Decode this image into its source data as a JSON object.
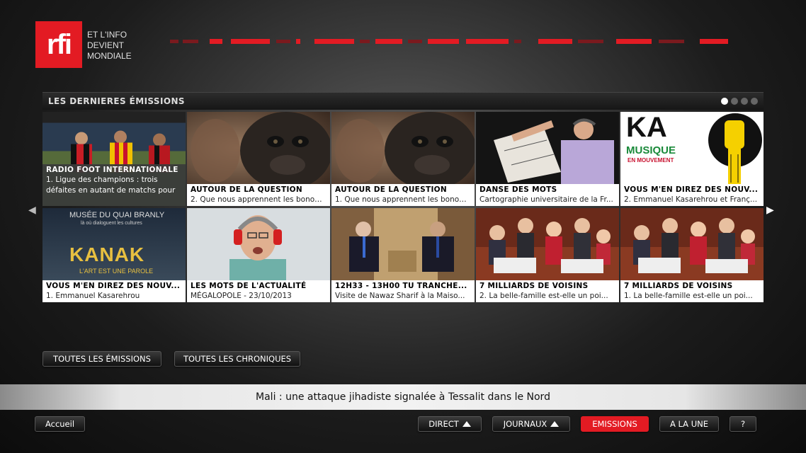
{
  "brand": {
    "logo_text": "rfi",
    "tagline": [
      "ET L'INFO",
      "DEVIENT",
      "MONDIALE"
    ],
    "accent_color": "#e31b23"
  },
  "section": {
    "title": "LES DERNIERES ÉMISSIONS",
    "page_count": 4,
    "current_page": 1
  },
  "tiles_row1": [
    {
      "title": "RADIO FOOT INTERNATIONALE",
      "subtitle": "1. Ligue des champions : trois défaites en autant de matchs pour",
      "image": "football-players"
    },
    {
      "title": "AUTOUR DE LA QUESTION",
      "subtitle": "2. Que nous apprennent les bonobo...",
      "image": "bonobo"
    },
    {
      "title": "AUTOUR DE LA QUESTION",
      "subtitle": "1. Que nous apprennent les bonobo...",
      "image": "bonobo"
    },
    {
      "title": "DANSE DES MOTS",
      "subtitle": "Cartographie universitaire de la Fr...",
      "image": "man-with-map"
    },
    {
      "title": "VOUS M'EN DIREZ DES NOUV...",
      "subtitle": "2. Emmanuel Kasarehrou et Franç...",
      "image": "ka-musique-poster",
      "poster_text": [
        "KA",
        "MUSIQUE",
        "EN MOUVEMENT"
      ]
    }
  ],
  "tiles_row2": [
    {
      "title": "VOUS M'EN DIREZ DES NOUV...",
      "subtitle": "1. Emmanuel Kasarehrou",
      "image": "kanak-poster",
      "poster_text": [
        "MUSÉE DU QUAI BRANLY",
        "là où dialoguent les cultures",
        "KANAK",
        "L'ART EST UNE PAROLE"
      ]
    },
    {
      "title": "LES MOTS DE L'ACTUALITÉ",
      "subtitle": "MÉGALOPOLE - 23/10/2013",
      "image": "man-with-headphones"
    },
    {
      "title": "12H33 - 13H00 TU TRANCHE...",
      "subtitle": "Visite de Nawaz Sharif à la Maiso...",
      "image": "two-men-seated"
    },
    {
      "title": "7 MILLIARDS DE VOISINS",
      "subtitle": "2. La belle-famille est-elle un poi...",
      "image": "family-on-sofa"
    },
    {
      "title": "7 MILLIARDS DE VOISINS",
      "subtitle": "1. La belle-famille est-elle un poi...",
      "image": "family-on-sofa"
    }
  ],
  "actions": {
    "all_shows": "TOUTES LES ÉMISSIONS",
    "all_chronicles": "TOUTES LES CHRONIQUES"
  },
  "ticker": {
    "text": "Mali : une attaque jihadiste signalée à Tessalit dans le Nord"
  },
  "nav": {
    "home": "Accueil",
    "direct": "DIRECT",
    "journaux": "JOURNAUX",
    "emissions": "EMISSIONS",
    "a_la_une": "A LA UNE",
    "help": "?"
  }
}
